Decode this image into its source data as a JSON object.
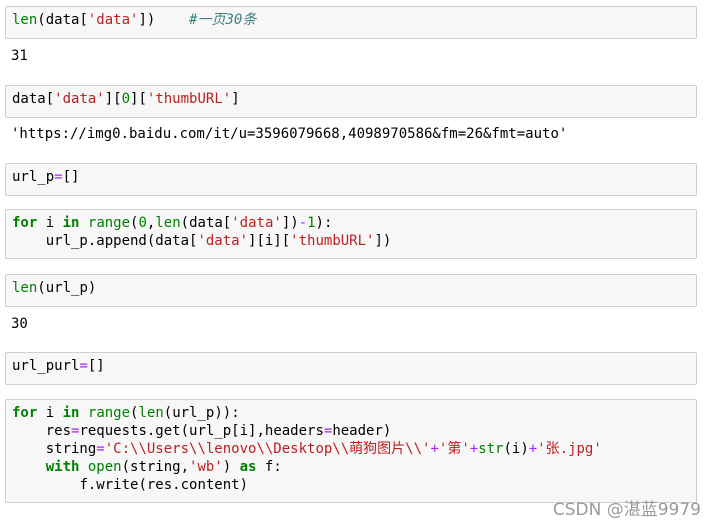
{
  "cells": {
    "c1": {
      "fn": "len",
      "p1": "(data[",
      "s1": "'data'",
      "p2": "])",
      "comment": "#一页30条"
    },
    "c2": {
      "p1": "data[",
      "s1": "'data'",
      "p2": "][",
      "n1": "0",
      "p3": "][",
      "s2": "'thumbURL'",
      "p4": "]"
    },
    "c3": {
      "v": "url_p",
      "op": "=",
      "rest": "[]"
    },
    "c4": {
      "l1": {
        "kw1": "for",
        "v": " i ",
        "kw2": "in",
        "sp": " ",
        "fn1": "range",
        "p1": "(",
        "n1": "0",
        "p2": ",",
        "fn2": "len",
        "p3": "(data[",
        "s1": "'data'",
        "p4": "])",
        "op": "-",
        "n2": "1",
        "p5": "):"
      },
      "l2": {
        "indent": "    ",
        "p1": "url_p.append(data[",
        "s1": "'data'",
        "p2": "][i][",
        "s2": "'thumbURL'",
        "p3": "])"
      }
    },
    "c5": {
      "fn": "len",
      "p1": "(url_p)"
    },
    "c6": {
      "v": "url_purl",
      "op": "=",
      "rest": "[]"
    },
    "c7": {
      "l1": {
        "kw1": "for",
        "v": " i ",
        "kw2": "in",
        "sp": " ",
        "fn1": "range",
        "p1": "(",
        "fn2": "len",
        "p2": "(url_p)):"
      },
      "l2": {
        "indent": "    ",
        "p1": "res",
        "op1": "=",
        "p2": "requests.get(url_p[i],headers",
        "op2": "=",
        "p3": "header)"
      },
      "l3": {
        "indent": "    ",
        "p1": "string",
        "op1": "=",
        "s1": "'C:\\\\Users\\\\lenovo\\\\Desktop\\\\萌狗图片\\\\'",
        "op2": "+",
        "s2": "'第'",
        "op3": "+",
        "fn": "str",
        "p2": "(i)",
        "op4": "+",
        "s3": "'张.jpg'"
      },
      "l4": {
        "indent": "    ",
        "kw1": "with",
        "sp": " ",
        "fn": "open",
        "p1": "(string,",
        "s1": "'wb'",
        "p2": ") ",
        "kw2": "as",
        "p3": " f:"
      },
      "l5": {
        "indent": "        ",
        "p1": "f.write(res.content)"
      }
    }
  },
  "outputs": {
    "o1": "31",
    "o2": "'https://img0.baidu.com/it/u=3596079668,4098970586&fm=26&fmt=auto'",
    "o5": "30"
  },
  "watermark": "CSDN @湛蓝9979"
}
